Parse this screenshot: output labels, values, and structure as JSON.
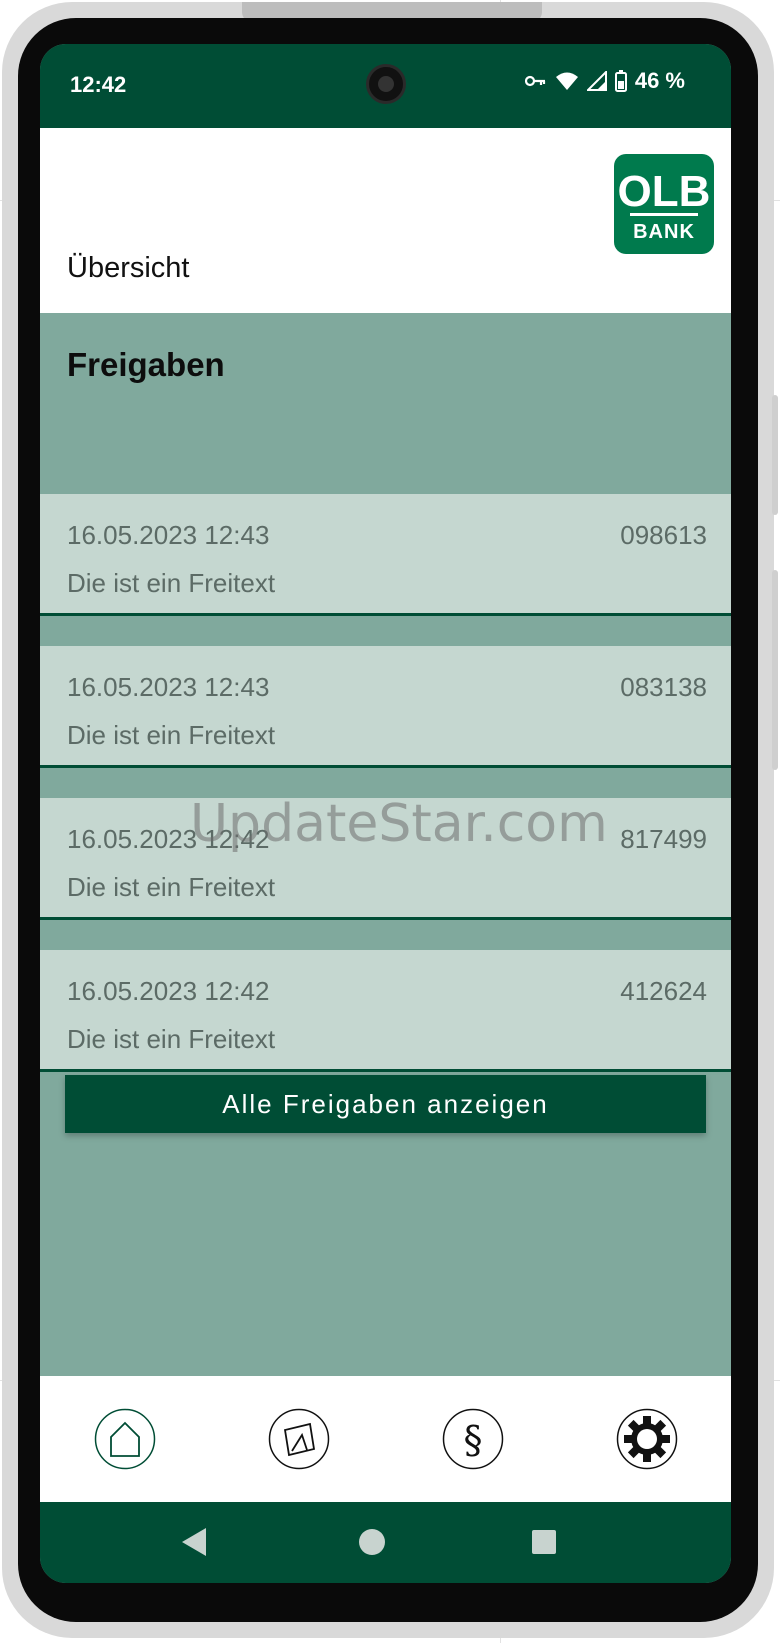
{
  "status_bar": {
    "time": "12:42",
    "battery": "46 %"
  },
  "header": {
    "title": "Übersicht",
    "logo_text_top": "OLB",
    "logo_text_bottom": "BANK"
  },
  "section": {
    "title": "Freigaben"
  },
  "releases": [
    {
      "datetime": "16.05.2023 12:43",
      "id": "098613",
      "text": "Die ist ein Freitext"
    },
    {
      "datetime": "16.05.2023 12:43",
      "id": "083138",
      "text": "Die ist ein Freitext"
    },
    {
      "datetime": "16.05.2023 12:42",
      "id": "817499",
      "text": "Die ist ein Freitext"
    },
    {
      "datetime": "16.05.2023 12:42",
      "id": "412624",
      "text": "Die ist ein Freitext"
    }
  ],
  "actions": {
    "show_all_label": "Alle Freigaben anzeigen"
  },
  "watermark": "UpdateStar.com",
  "bottom_nav": [
    {
      "icon": "home-icon"
    },
    {
      "icon": "document-icon"
    },
    {
      "icon": "paragraph-icon"
    },
    {
      "icon": "gear-icon"
    }
  ],
  "colors": {
    "primary_dark": "#004d35",
    "content_bg": "#80a99d",
    "card_bg": "#c5d7d0",
    "logo_green": "#007a4d"
  }
}
